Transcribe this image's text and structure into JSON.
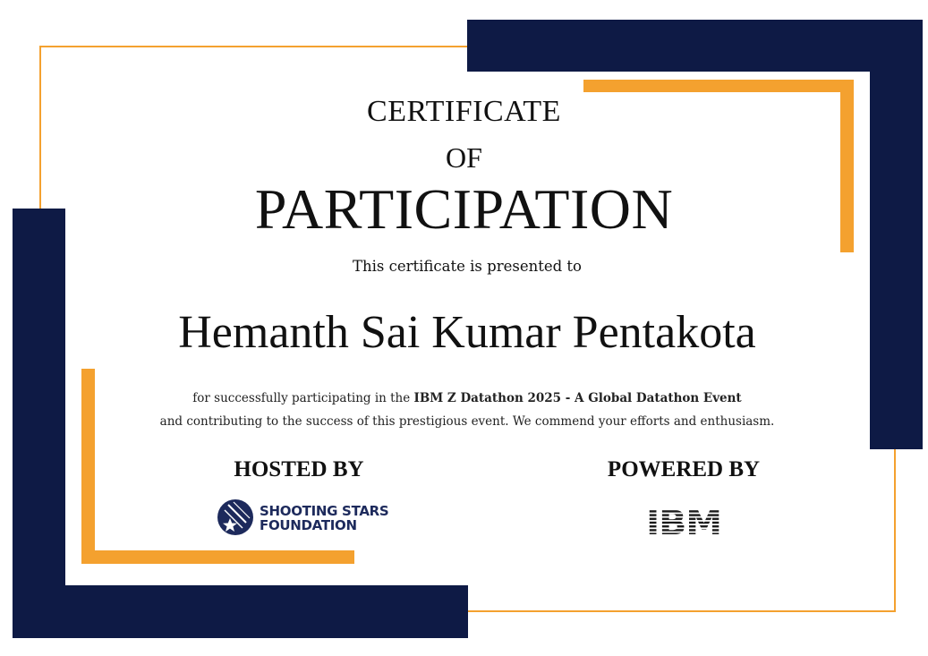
{
  "certificate": {
    "title_line1": "CERTIFICATE",
    "title_line2": "OF",
    "title_line3": "PARTICIPATION",
    "presented_text": "This certificate is presented to",
    "recipient_name": "Hemanth Sai Kumar Pentakota",
    "description_prefix": "for successfully participating in the ",
    "event_name": "IBM Z Datathon 2025 - A Global Datathon Event",
    "description_line2": "and contributing to the success of this prestigious event. We commend your efforts and enthusiasm."
  },
  "hosted": {
    "label": "HOSTED BY",
    "org_line1": "SHOOTING STARS",
    "org_line2": "FOUNDATION"
  },
  "powered": {
    "label": "POWERED BY",
    "org_logo_text": "IBM"
  },
  "colors": {
    "navy": "#0e1a45",
    "orange": "#f4a12f"
  },
  "icons": {
    "hosted_logo": "shooting-star-icon",
    "powered_logo": "ibm-logo"
  }
}
